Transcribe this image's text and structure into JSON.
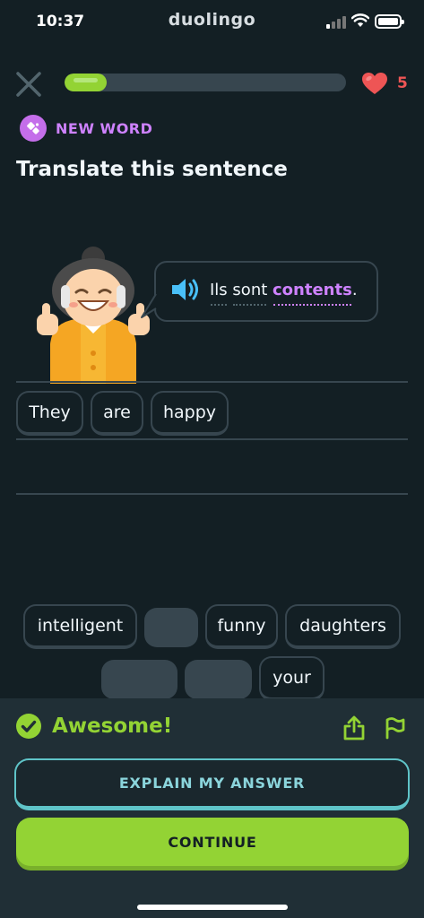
{
  "status_bar": {
    "time": "10:37",
    "app_name": "duolingo"
  },
  "progress": {
    "fraction": 0.15
  },
  "hearts": {
    "count": "5"
  },
  "badge": {
    "label": "NEW WORD"
  },
  "prompt": "Translate this sentence",
  "sentence": {
    "words": [
      "Ils",
      "sont",
      "contents",
      "."
    ],
    "highlighted_word": "contents"
  },
  "answer_tiles": [
    "They",
    "are",
    "happy"
  ],
  "word_bank": {
    "row1": [
      "intelligent",
      "",
      "funny",
      "daughters"
    ],
    "row2": [
      "",
      "",
      "your"
    ]
  },
  "feedback": {
    "title": "Awesome!",
    "explain_label": "EXPLAIN MY ANSWER",
    "continue_label": "CONTINUE"
  },
  "colors": {
    "background": "#131f24",
    "accent_green": "#93d334",
    "accent_purple": "#ce82ff",
    "heart_red": "#ee5555",
    "explain_teal": "#5fc4c8"
  },
  "icons": [
    "close-icon",
    "heart-icon",
    "new-word-icon",
    "speaker-icon",
    "checkmark-icon",
    "share-icon",
    "flag-icon"
  ]
}
